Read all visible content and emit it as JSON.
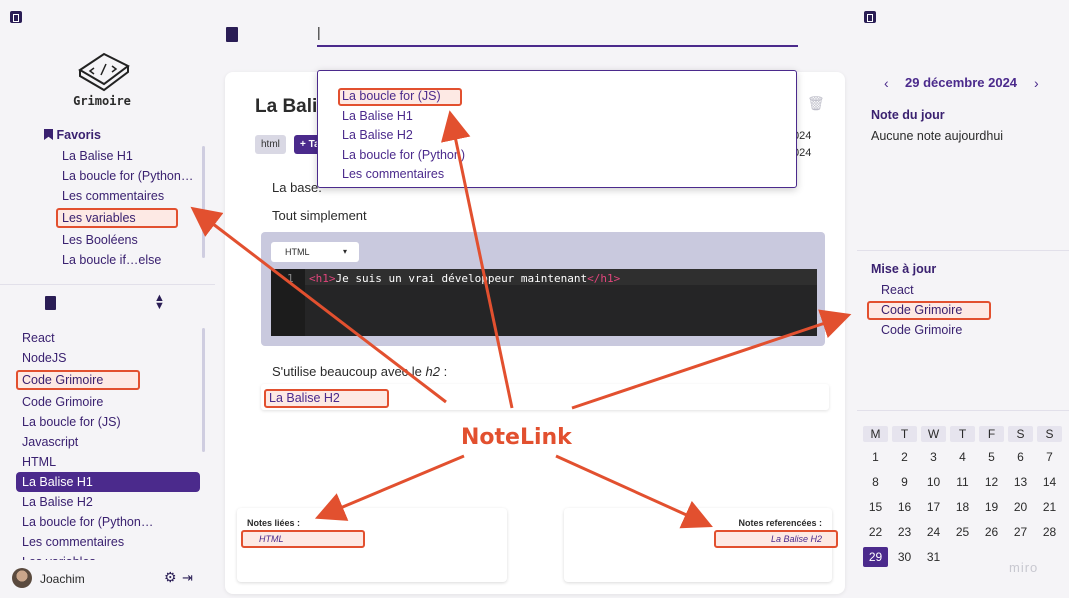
{
  "left": {
    "app_name": "Grimoire",
    "favorites_title": "Favoris",
    "favorites": [
      "La Balise H1",
      "La boucle for (Python…",
      "Les commentaires",
      "Les variables",
      "Les Booléens",
      "La boucle if…else"
    ],
    "notes": [
      "React",
      "NodeJS",
      "Code Grimoire",
      "Code Grimoire",
      "La boucle for (JS)",
      "Javascript",
      "HTML",
      "La Balise H1",
      "La Balise H2",
      "La boucle for (Python…",
      "Les commentaires",
      "Les variables"
    ],
    "user": "Joachim"
  },
  "search": {
    "value": "|"
  },
  "dropdown": [
    "La boucle for (JS)",
    "La Balise H1",
    "La Balise H2",
    "La boucle for (Python)",
    "Les commentaires"
  ],
  "note": {
    "title": "La Bali",
    "tag": "html",
    "add_tag": "+ Ta",
    "date1": "024",
    "date2": "024",
    "line1": "La base.",
    "line2": "Tout simplement",
    "code_lang": "HTML",
    "code_line_no": "1",
    "code_open": "<h1>",
    "code_text": "Je suis un vrai développeur maintenant",
    "code_close": "</h1>",
    "line3_prefix": "S'utilise beaucoup avec le ",
    "line3_em": "h2",
    "line3_suffix": " :",
    "link": "La Balise H2",
    "linked_title": "Notes liées :",
    "linked_value": "HTML",
    "referenced_title": "Notes referencées :",
    "referenced_value": "La Balise H2"
  },
  "annotation": "NoteLink",
  "right": {
    "date": "29 décembre 2024",
    "note_du_jour": "Note du jour",
    "no_note": "Aucune note aujourdhui",
    "updates_title": "Mise à jour",
    "updates": [
      "React",
      "Code Grimoire",
      "Code Grimoire"
    ],
    "weekdays": [
      "M",
      "T",
      "W",
      "T",
      "F",
      "S",
      "S"
    ],
    "weeks": [
      [
        "1",
        "2",
        "3",
        "4",
        "5",
        "6",
        "7"
      ],
      [
        "8",
        "9",
        "10",
        "11",
        "12",
        "13",
        "14"
      ],
      [
        "15",
        "16",
        "17",
        "18",
        "19",
        "20",
        "21"
      ],
      [
        "22",
        "23",
        "24",
        "25",
        "26",
        "27",
        "28"
      ],
      [
        "29",
        "30",
        "31",
        "",
        "",
        "",
        ""
      ]
    ],
    "watermark": "miro"
  },
  "colors": {
    "accent": "#4b2a8c",
    "highlight": "#e2502f"
  }
}
